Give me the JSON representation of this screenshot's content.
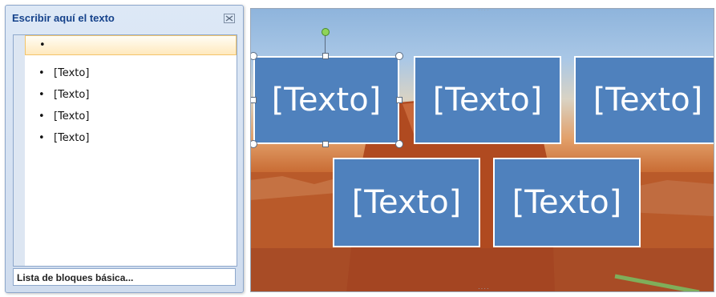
{
  "text_pane": {
    "title": "Escribir aquí el texto",
    "close_icon": "close-icon",
    "items": [
      {
        "bullet": "•",
        "text": ""
      },
      {
        "bullet": "•",
        "text": "[Texto]"
      },
      {
        "bullet": "•",
        "text": "[Texto]"
      },
      {
        "bullet": "•",
        "text": "[Texto]"
      },
      {
        "bullet": "•",
        "text": "[Texto]"
      }
    ],
    "layout_name": "Lista de bloques básica..."
  },
  "canvas": {
    "shapes": [
      {
        "text": "[Texto]",
        "selected": true
      },
      {
        "text": "[Texto]"
      },
      {
        "text": "[Texto]"
      },
      {
        "text": "[Texto]"
      },
      {
        "text": "[Texto]"
      }
    ],
    "shape_fill": "#4f81bd",
    "shape_border": "#ffffff"
  }
}
